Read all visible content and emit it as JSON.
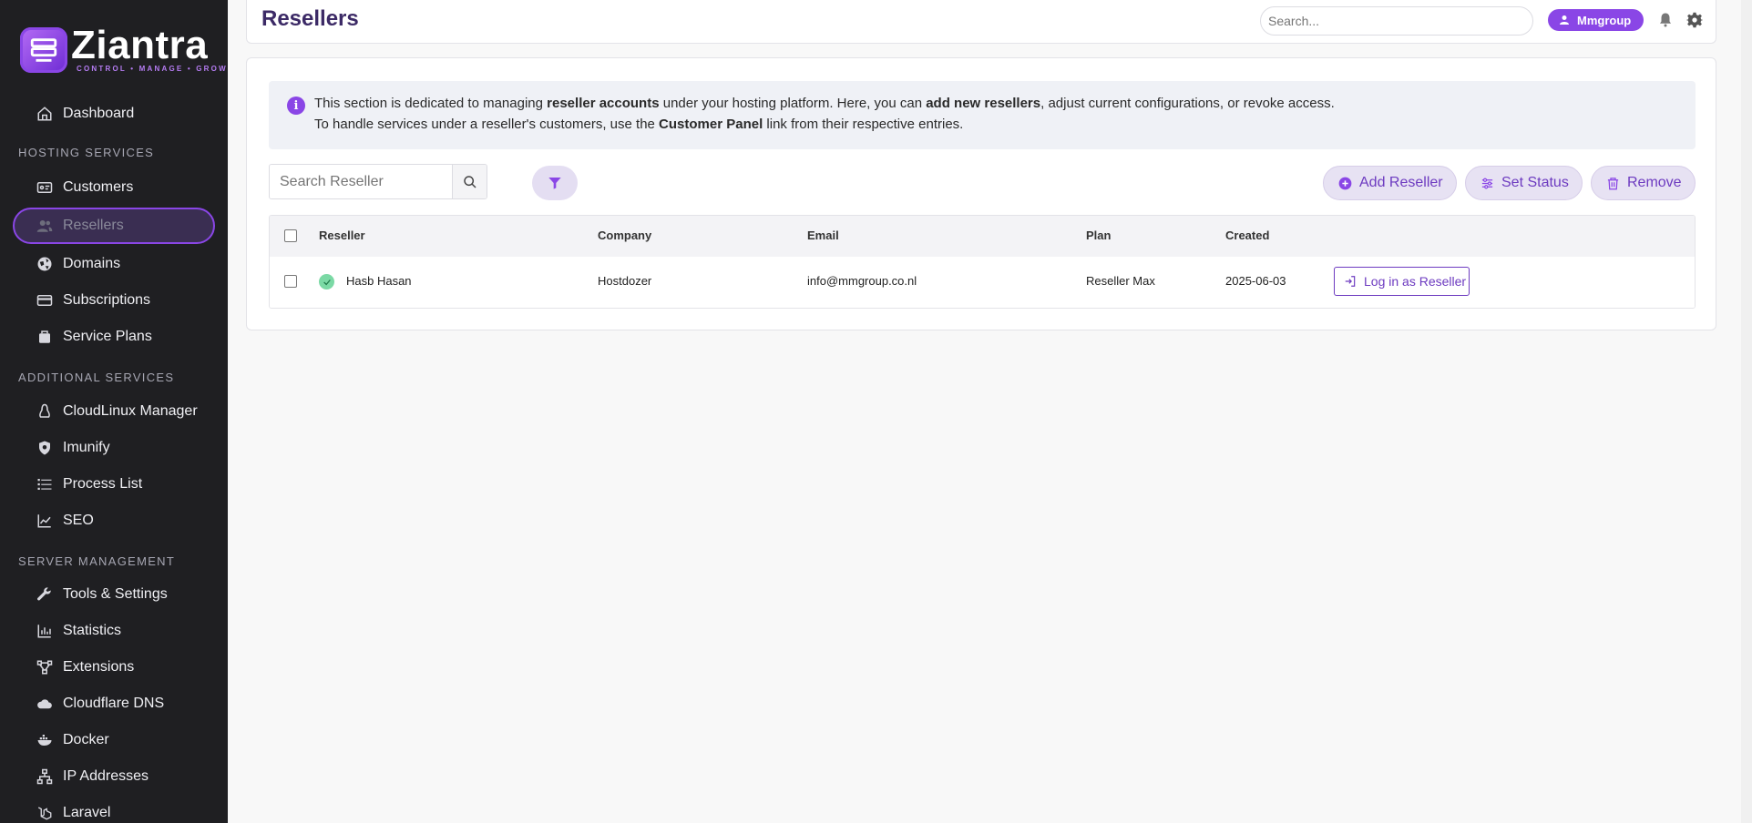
{
  "brand": {
    "name": "Ziantra",
    "tagline": "CONTROL • MANAGE • GROW",
    "accent": "#8a46e6"
  },
  "sidebar": {
    "items": [
      {
        "label": "Dashboard",
        "icon": "home-icon"
      },
      {
        "section": "HOSTING SERVICES"
      },
      {
        "label": "Customers",
        "icon": "id-card-icon"
      },
      {
        "label": "Resellers",
        "icon": "users-icon",
        "active": true
      },
      {
        "label": "Domains",
        "icon": "globe-icon"
      },
      {
        "label": "Subscriptions",
        "icon": "card-icon"
      },
      {
        "label": "Service Plans",
        "icon": "box-icon"
      },
      {
        "section": "ADDITIONAL SERVICES"
      },
      {
        "label": "CloudLinux Manager",
        "icon": "linux-icon"
      },
      {
        "label": "Imunify",
        "icon": "shield-icon"
      },
      {
        "label": "Process List",
        "icon": "list-icon"
      },
      {
        "label": "SEO",
        "icon": "chart-line-icon"
      },
      {
        "section": "SERVER MANAGEMENT"
      },
      {
        "label": "Tools & Settings",
        "icon": "wrench-icon"
      },
      {
        "label": "Statistics",
        "icon": "bar-chart-icon"
      },
      {
        "label": "Extensions",
        "icon": "network-icon"
      },
      {
        "label": "Cloudflare DNS",
        "icon": "cloud-icon"
      },
      {
        "label": "Docker",
        "icon": "docker-icon"
      },
      {
        "label": "IP Addresses",
        "icon": "sitemap-icon"
      },
      {
        "label": "Laravel",
        "icon": "laravel-icon"
      }
    ]
  },
  "header": {
    "title": "Resellers",
    "search_placeholder": "Search...",
    "user": "Mmgroup"
  },
  "info": {
    "l1_a": "This section is dedicated to managing ",
    "l1_b": "reseller accounts",
    "l1_c": " under your hosting platform. Here, you can ",
    "l1_d": "add new resellers",
    "l1_e": ", adjust current configurations, or revoke access.",
    "l2_a": "To handle services under a reseller's customers, use the ",
    "l2_b": "Customer Panel",
    "l2_c": " link from their respective entries."
  },
  "toolbar": {
    "search_placeholder": "Search Reseller",
    "add": "Add Reseller",
    "status": "Set Status",
    "remove": "Remove"
  },
  "table": {
    "headers": {
      "reseller": "Reseller",
      "company": "Company",
      "email": "Email",
      "plan": "Plan",
      "created": "Created"
    },
    "rows": [
      {
        "reseller": "Hasb Hasan",
        "company": "Hostdozer",
        "email": "info@mmgroup.co.nl",
        "plan": "Reseller Max",
        "created": "2025-06-03",
        "action": "Log in as Reseller"
      }
    ]
  }
}
